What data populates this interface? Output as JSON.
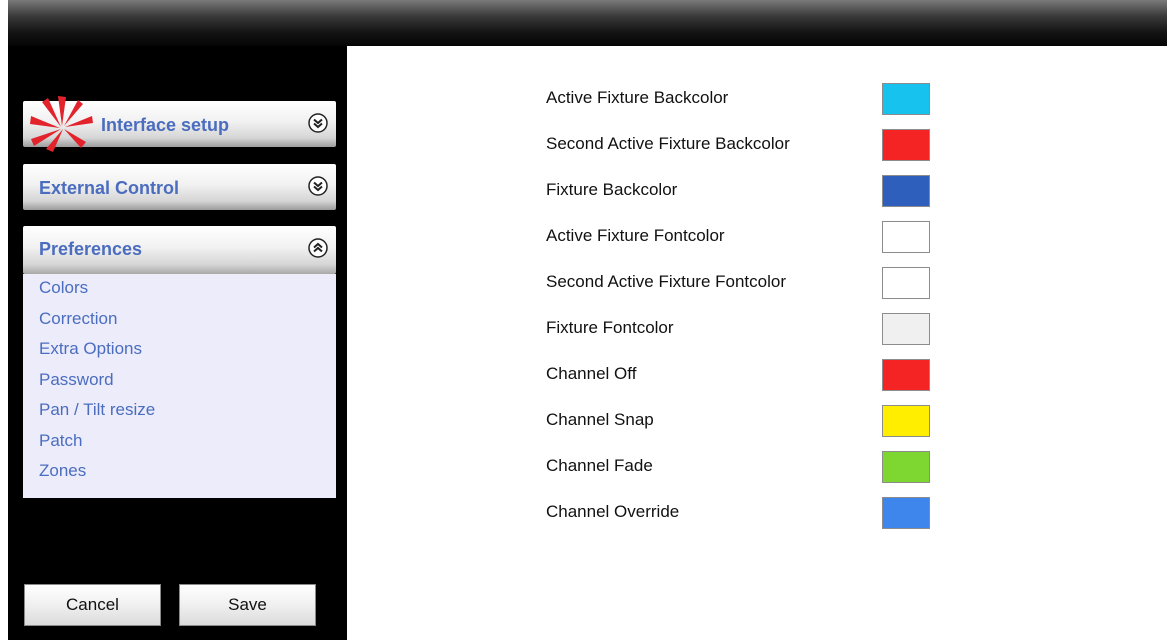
{
  "sidebar": {
    "panels": {
      "interface_setup": {
        "label": "Interface setup",
        "chevron": "chevron-double-down-icon"
      },
      "external_control": {
        "label": "External Control",
        "chevron": "chevron-double-down-icon"
      },
      "preferences": {
        "label": "Preferences",
        "chevron": "chevron-double-up-icon"
      }
    },
    "preference_items": [
      "Colors",
      "Correction",
      "Extra Options",
      "Password",
      "Pan / Tilt resize",
      "Patch",
      "Zones"
    ],
    "buttons": {
      "cancel": "Cancel",
      "save": "Save"
    },
    "accent_color": "#4b6dbf"
  },
  "colors": [
    {
      "label": "Active Fixture Backcolor",
      "color": "#17c2ef"
    },
    {
      "label": "Second Active Fixture Backcolor",
      "color": "#f52424"
    },
    {
      "label": "Fixture Backcolor",
      "color": "#2f5fbd"
    },
    {
      "label": "Active Fixture Fontcolor",
      "color": "#ffffff"
    },
    {
      "label": "Second Active Fixture Fontcolor",
      "color": "#ffffff"
    },
    {
      "label": "Fixture Fontcolor",
      "color": "#f0f0f0"
    },
    {
      "label": "Channel Off",
      "color": "#f52424"
    },
    {
      "label": "Channel Snap",
      "color": "#ffee00"
    },
    {
      "label": "Channel Fade",
      "color": "#7ed630"
    },
    {
      "label": "Channel Override",
      "color": "#3e85ec"
    }
  ]
}
